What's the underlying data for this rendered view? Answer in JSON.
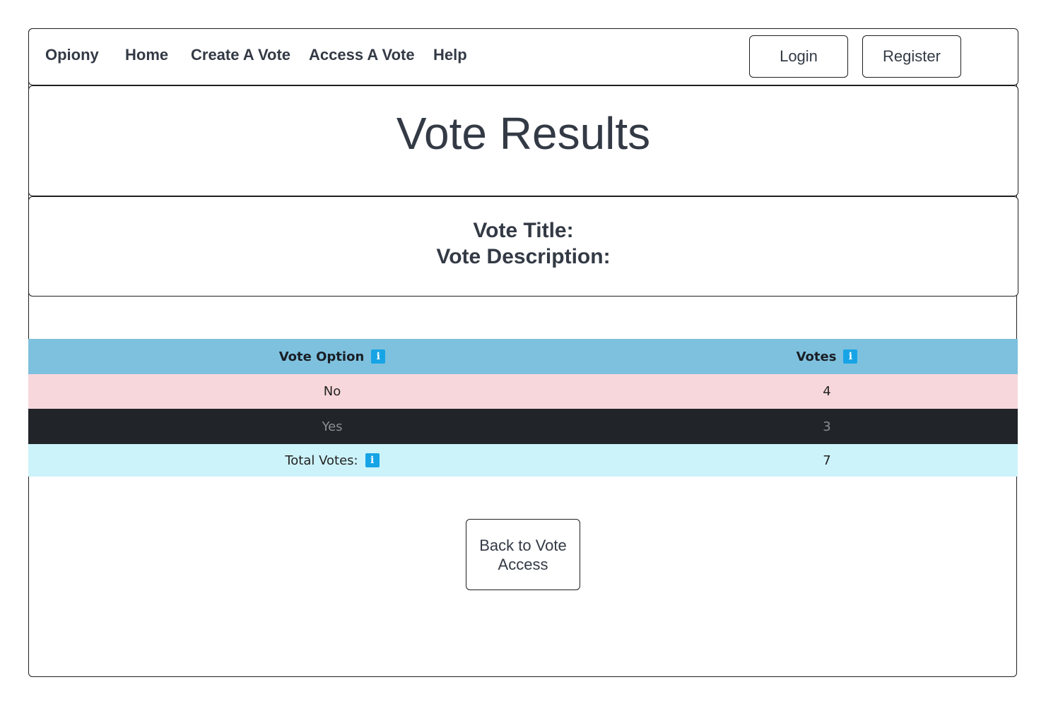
{
  "navbar": {
    "brand": "Opiony",
    "links": [
      "Home",
      "Create A Vote",
      "Access A Vote",
      "Help"
    ],
    "login_label": "Login",
    "register_label": "Register"
  },
  "header": {
    "title": "Vote Results"
  },
  "vote_info": {
    "title_label": "Vote Title:",
    "description_label": "Vote Description:"
  },
  "results_table": {
    "columns": [
      "Vote Option",
      "Votes"
    ],
    "rows": [
      {
        "option": "No",
        "votes": "4"
      },
      {
        "option": "Yes",
        "votes": "3"
      }
    ],
    "total_label": "Total Votes:",
    "total_value": "7",
    "info_icon_glyph": "i",
    "colors": {
      "header_bg": "#7ec1de",
      "row_no_bg": "#f7d7db",
      "row_yes_bg": "#212429",
      "total_bg": "#cdf3fa",
      "info_icon_bg": "#16a4e6"
    }
  },
  "actions": {
    "back_label": "Back to Vote Access"
  }
}
